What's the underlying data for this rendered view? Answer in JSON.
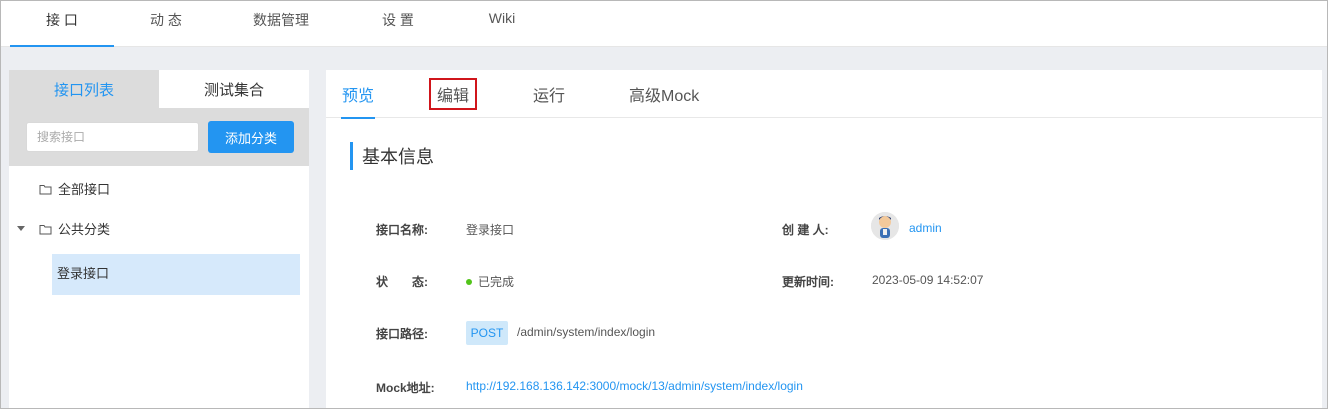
{
  "topnav": {
    "tabs": [
      {
        "label": "接 口"
      },
      {
        "label": "动 态"
      },
      {
        "label": "数据管理"
      },
      {
        "label": "设 置"
      },
      {
        "label": "Wiki"
      }
    ]
  },
  "left": {
    "tabs": [
      {
        "label": "接口列表"
      },
      {
        "label": "测试集合"
      }
    ],
    "search": {
      "placeholder": "搜索接口",
      "value": ""
    },
    "add_button": "添加分类",
    "tree": {
      "all": "全部接口",
      "category": "公共分类",
      "leaf": "登录接口"
    }
  },
  "right": {
    "tabs": [
      {
        "label": "预览"
      },
      {
        "label": "编辑"
      },
      {
        "label": "运行"
      },
      {
        "label": "高级Mock"
      }
    ],
    "section_title": "基本信息",
    "fields": {
      "name_label": "接口名称:",
      "name_value": "登录接口",
      "creator_label": "创 建 人:",
      "creator_value": "admin",
      "status_label": "状　　态:",
      "status_value": "已完成",
      "updated_label": "更新时间:",
      "updated_value": "2023-05-09 14:52:07",
      "path_label": "接口路径:",
      "method": "POST",
      "path_value": "/admin/system/index/login",
      "mock_label": "Mock地址:",
      "mock_value": "http://192.168.136.142:3000/mock/13/admin/system/index/login"
    }
  },
  "colors": {
    "accent": "#2395f1",
    "status_done": "#52c41a",
    "highlight_box": "#d0151b"
  }
}
